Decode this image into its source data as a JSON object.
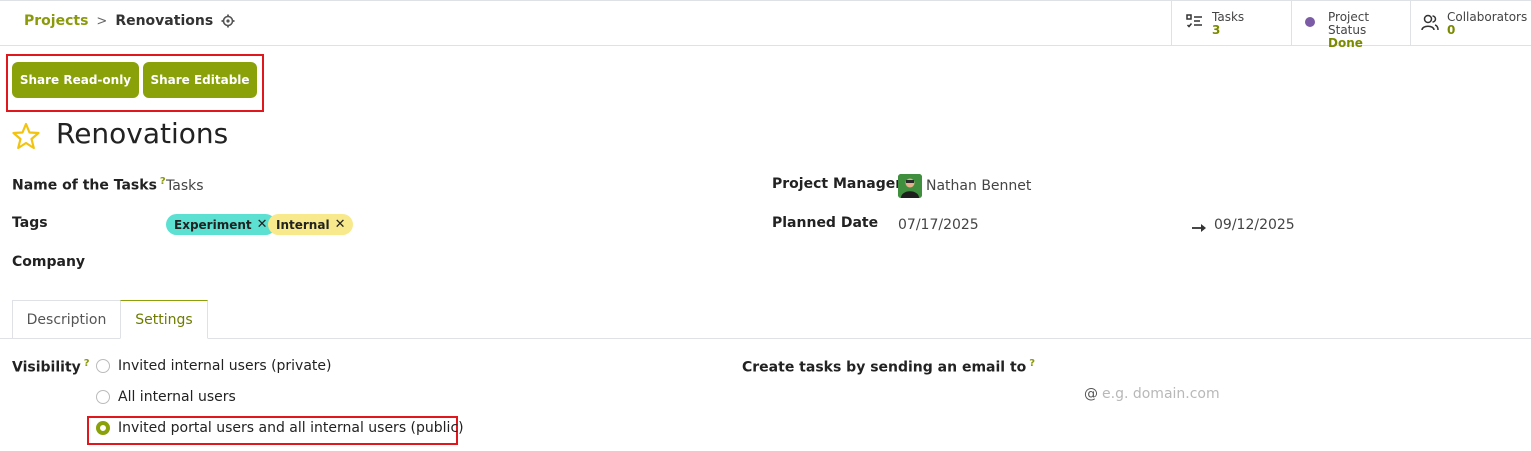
{
  "breadcrumb": {
    "parent": "Projects",
    "separator": ">",
    "current": "Renovations"
  },
  "stats": {
    "tasks": {
      "label": "Tasks",
      "value": "3"
    },
    "status": {
      "label": "Project Status",
      "value": "Done",
      "color": "#7b5aa6"
    },
    "collaborators": {
      "label": "Collaborators",
      "value": "0"
    }
  },
  "actions": {
    "share_readonly": "Share Read-only",
    "share_editable": "Share Editable"
  },
  "project": {
    "title": "Renovations"
  },
  "fields": {
    "tasks_name_label": "Name of the Tasks",
    "tasks_name_help": "?",
    "tasks_name_value": "Tasks",
    "tags_label": "Tags",
    "tags": [
      {
        "label": "Experiment",
        "color": "#5ce0d2"
      },
      {
        "label": "Internal",
        "color": "#f7e98c"
      }
    ],
    "company_label": "Company",
    "manager_label": "Project Manager",
    "manager_value": "Nathan Bennet",
    "planned_label": "Planned Date",
    "planned_start": "07/17/2025",
    "planned_end": "09/12/2025"
  },
  "tabs": {
    "description": "Description",
    "settings": "Settings"
  },
  "settings": {
    "visibility_label": "Visibility",
    "visibility_help": "?",
    "options": [
      {
        "label": "Invited internal users (private)",
        "selected": false
      },
      {
        "label": "All internal users",
        "selected": false
      },
      {
        "label": "Invited portal users and all internal users (public)",
        "selected": true
      }
    ],
    "email_label": "Create tasks by sending an email to",
    "email_help": "?",
    "email_at": "@",
    "email_placeholder": "e.g. domain.com"
  },
  "colors": {
    "accent": "#8aa10a",
    "highlight_box": "#e0181e"
  }
}
